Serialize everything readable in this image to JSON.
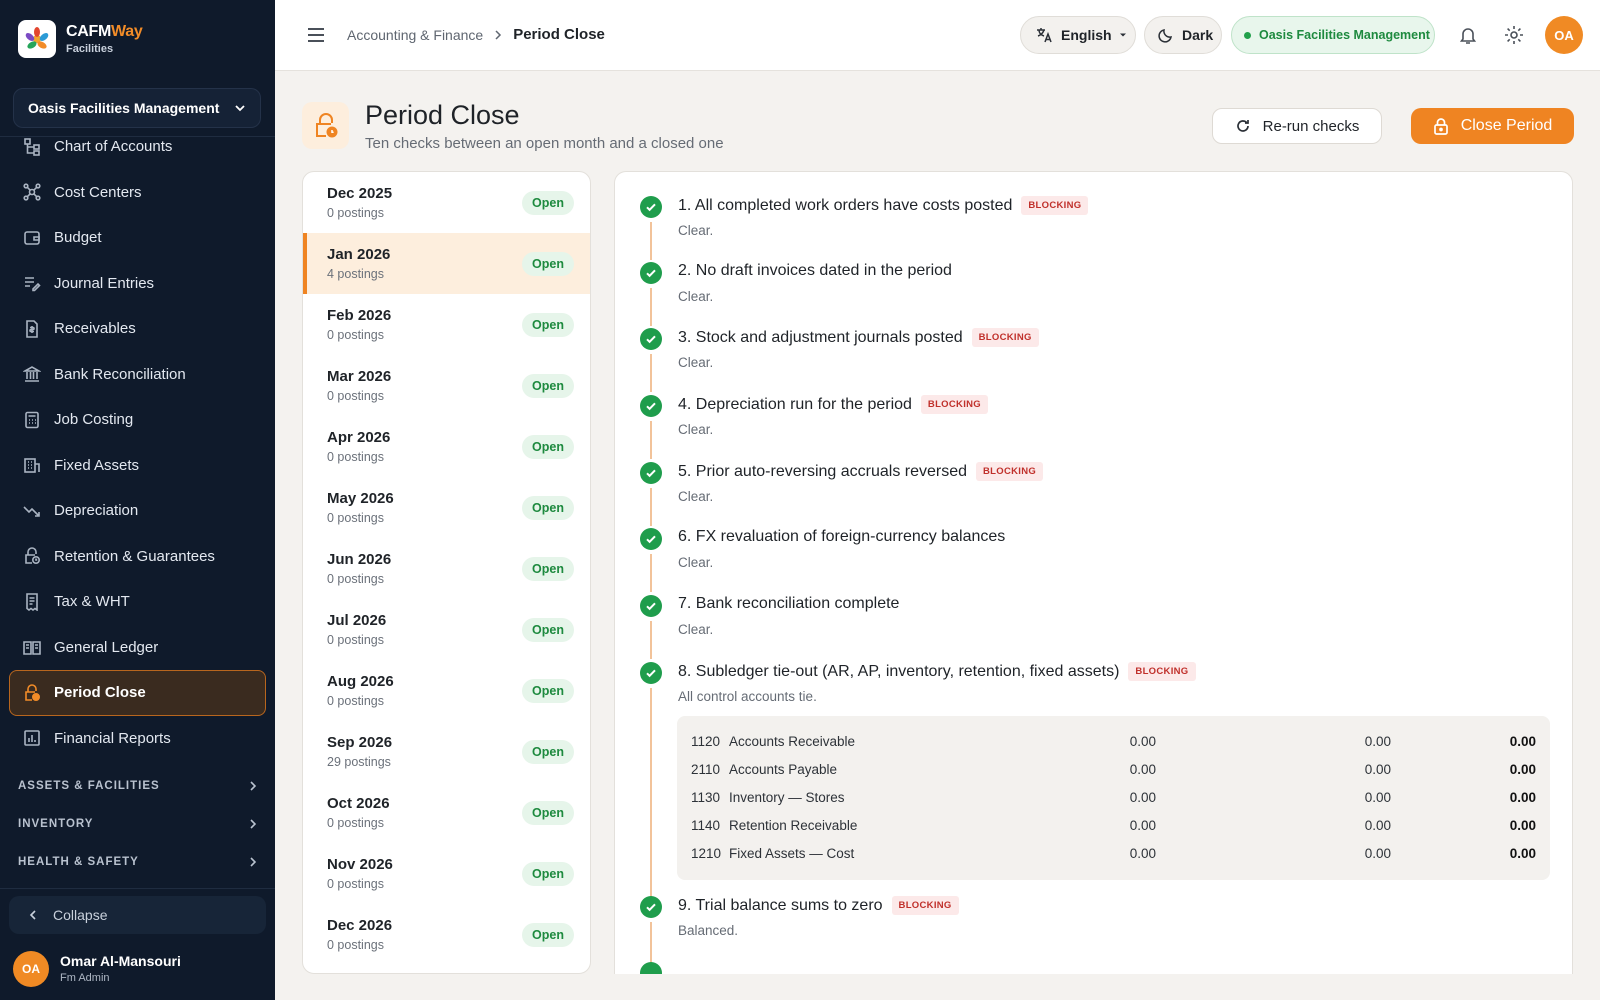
{
  "brand": {
    "name_main": "CAFM",
    "name_accent": "Way",
    "sub": "Facilities"
  },
  "sidebar": {
    "org": "Oasis Facilities Management",
    "items": [
      {
        "label": "Chart of Accounts",
        "icon": "hierarchy-icon"
      },
      {
        "label": "Cost Centers",
        "icon": "network-icon"
      },
      {
        "label": "Budget",
        "icon": "wallet-icon"
      },
      {
        "label": "Journal Entries",
        "icon": "edit-lines-icon"
      },
      {
        "label": "Receivables",
        "icon": "invoice-icon"
      },
      {
        "label": "Bank Reconciliation",
        "icon": "bank-icon"
      },
      {
        "label": "Job Costing",
        "icon": "calculator-icon"
      },
      {
        "label": "Fixed Assets",
        "icon": "building-icon"
      },
      {
        "label": "Depreciation",
        "icon": "trend-down-icon"
      },
      {
        "label": "Retention & Guarantees",
        "icon": "lock-clock-icon"
      },
      {
        "label": "Tax & WHT",
        "icon": "receipt-icon"
      },
      {
        "label": "General Ledger",
        "icon": "ledger-book-icon"
      },
      {
        "label": "Period Close",
        "icon": "lock-clock-icon",
        "active": true
      },
      {
        "label": "Financial Reports",
        "icon": "bar-chart-icon"
      }
    ],
    "sections": [
      "ASSETS & FACILITIES",
      "INVENTORY",
      "HEALTH & SAFETY"
    ],
    "collapse": "Collapse",
    "user": {
      "initials": "OA",
      "name": "Omar Al-Mansouri",
      "role": "Fm Admin"
    }
  },
  "topbar": {
    "crumb_parent": "Accounting & Finance",
    "crumb_current": "Period Close",
    "language": "English",
    "theme": "Dark",
    "org": "Oasis Facilities Management",
    "avatar": "OA"
  },
  "page": {
    "title": "Period Close",
    "subtitle": "Ten checks between an open month and a closed one",
    "rerun": "Re-run checks",
    "close": "Close Period"
  },
  "periods": [
    {
      "month": "Dec 2025",
      "count": "0 postings",
      "status": "Open"
    },
    {
      "month": "Jan 2026",
      "count": "4 postings",
      "status": "Open",
      "selected": true
    },
    {
      "month": "Feb 2026",
      "count": "0 postings",
      "status": "Open"
    },
    {
      "month": "Mar 2026",
      "count": "0 postings",
      "status": "Open"
    },
    {
      "month": "Apr 2026",
      "count": "0 postings",
      "status": "Open"
    },
    {
      "month": "May 2026",
      "count": "0 postings",
      "status": "Open"
    },
    {
      "month": "Jun 2026",
      "count": "0 postings",
      "status": "Open"
    },
    {
      "month": "Jul 2026",
      "count": "0 postings",
      "status": "Open"
    },
    {
      "month": "Aug 2026",
      "count": "0 postings",
      "status": "Open"
    },
    {
      "month": "Sep 2026",
      "count": "29 postings",
      "status": "Open"
    },
    {
      "month": "Oct 2026",
      "count": "0 postings",
      "status": "Open"
    },
    {
      "month": "Nov 2026",
      "count": "0 postings",
      "status": "Open"
    },
    {
      "month": "Dec 2026",
      "count": "0 postings",
      "status": "Open"
    }
  ],
  "checks": [
    {
      "title": "1. All completed work orders have costs posted",
      "blocking": "BLOCKING",
      "note": "Clear."
    },
    {
      "title": "2. No draft invoices dated in the period",
      "note": "Clear."
    },
    {
      "title": "3. Stock and adjustment journals posted",
      "blocking": "BLOCKING",
      "note": "Clear."
    },
    {
      "title": "4. Depreciation run for the period",
      "blocking": "BLOCKING",
      "note": "Clear."
    },
    {
      "title": "5. Prior auto-reversing accruals reversed",
      "blocking": "BLOCKING",
      "note": "Clear."
    },
    {
      "title": "6. FX revaluation of foreign-currency balances",
      "note": "Clear."
    },
    {
      "title": "7. Bank reconciliation complete",
      "note": "Clear."
    },
    {
      "title": "8. Subledger tie-out (AR, AP, inventory, retention, fixed assets)",
      "blocking": "BLOCKING",
      "note": "All control accounts tie."
    },
    {
      "title": "9. Trial balance sums to zero",
      "blocking": "BLOCKING",
      "note": "Balanced."
    }
  ],
  "tieout": [
    {
      "code": "1120",
      "name": "Accounts Receivable",
      "a": "0.00",
      "b": "0.00",
      "c": "0.00"
    },
    {
      "code": "2110",
      "name": "Accounts Payable",
      "a": "0.00",
      "b": "0.00",
      "c": "0.00"
    },
    {
      "code": "1130",
      "name": "Inventory — Stores",
      "a": "0.00",
      "b": "0.00",
      "c": "0.00"
    },
    {
      "code": "1140",
      "name": "Retention Receivable",
      "a": "0.00",
      "b": "0.00",
      "c": "0.00"
    },
    {
      "code": "1210",
      "name": "Fixed Assets — Cost",
      "a": "0.00",
      "b": "0.00",
      "c": "0.00"
    }
  ]
}
